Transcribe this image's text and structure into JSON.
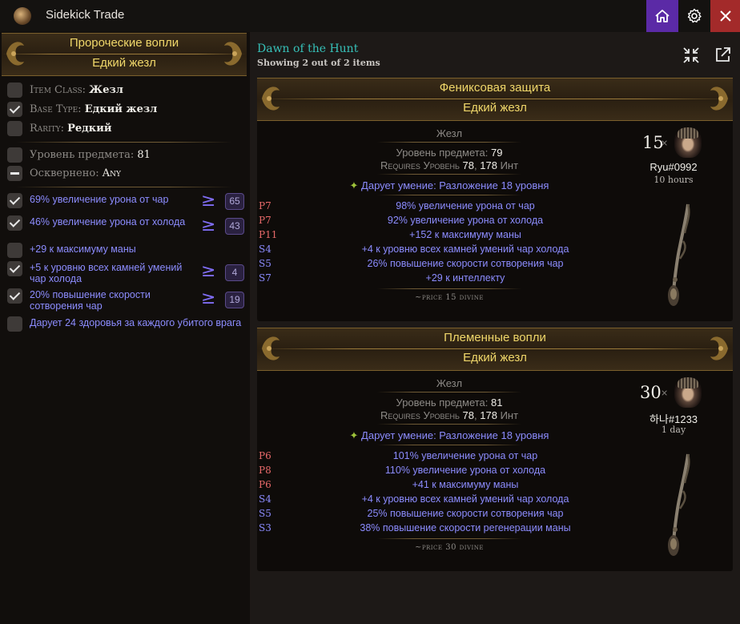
{
  "app": {
    "title": "Sidekick Trade"
  },
  "filters": {
    "banner": {
      "name": "Пророческие вопли",
      "base": "Едкий жезл"
    },
    "rows": [
      {
        "label": "Item Class:",
        "value": "Жезл",
        "state": "off"
      },
      {
        "label": "Base Type:",
        "value": "Едкий жезл",
        "state": "on"
      },
      {
        "label": "Rarity:",
        "value": "Редкий",
        "state": "off"
      },
      {
        "label": "Уровень предмета:",
        "value": "81",
        "state": "off"
      },
      {
        "label": "Осквернено:",
        "value": "Any",
        "state": "minus"
      }
    ],
    "mods": [
      {
        "text": "69% увеличение урона от чар",
        "checked": true,
        "min": "65"
      },
      {
        "text": "46% увеличение урона от холода",
        "checked": true,
        "min": "43"
      },
      {
        "text": "+29 к максимуму маны",
        "checked": false,
        "min": ""
      },
      {
        "text": "+5 к уровню всех камней умений чар холода",
        "checked": true,
        "min": "4"
      },
      {
        "text": "20% повышение скорости сотворения чар",
        "checked": true,
        "min": "19"
      },
      {
        "text": "Дарует 24 здоровья за каждого убитого врага",
        "checked": false,
        "min": ""
      }
    ]
  },
  "results": {
    "league": "Dawn of the Hunt",
    "showing": "Showing 2 out of 2 items",
    "items": [
      {
        "name": "Фениксовая защита",
        "base": "Едкий жезл",
        "item_class": "Жезл",
        "ilvl_label": "Уровень предмета:",
        "ilvl": "79",
        "req_label": "Requires Уровень",
        "req_level": "78",
        "req_int": "178",
        "req_int_label": "Инт",
        "skill": "Дарует умение: Разложение 18 уровня",
        "mods": [
          {
            "tag": "P7",
            "kind": "p",
            "text": "98% увеличение урона от чар"
          },
          {
            "tag": "P7",
            "kind": "p",
            "text": "92% увеличение урона от холода"
          },
          {
            "tag": "P11",
            "kind": "p",
            "text": "+152 к максимуму маны"
          },
          {
            "tag": "S4",
            "kind": "s",
            "text": "+4 к уровню всех камней умений чар холода"
          },
          {
            "tag": "S5",
            "kind": "s",
            "text": "26% повышение скорости сотворения чар"
          },
          {
            "tag": "S7",
            "kind": "s",
            "text": "+29 к интеллекту"
          }
        ],
        "price": "~price 15 divine",
        "stock": "15",
        "seller": "Ryu#0992",
        "age": "10 hours"
      },
      {
        "name": "Племенные вопли",
        "base": "Едкий жезл",
        "item_class": "Жезл",
        "ilvl_label": "Уровень предмета:",
        "ilvl": "81",
        "req_label": "Requires Уровень",
        "req_level": "78",
        "req_int": "178",
        "req_int_label": "Инт",
        "skill": "Дарует умение: Разложение 18 уровня",
        "mods": [
          {
            "tag": "P6",
            "kind": "p",
            "text": "101% увеличение урона от чар"
          },
          {
            "tag": "P8",
            "kind": "p",
            "text": "110% увеличение урона от холода"
          },
          {
            "tag": "P6",
            "kind": "p",
            "text": "+41 к максимуму маны"
          },
          {
            "tag": "S4",
            "kind": "s",
            "text": "+4 к уровню всех камней умений чар холода"
          },
          {
            "tag": "S5",
            "kind": "s",
            "text": "25% повышение скорости сотворения чар"
          },
          {
            "tag": "S3",
            "kind": "s",
            "text": "38% повышение скорости регенерации маны"
          }
        ],
        "price": "~price 30 divine",
        "stock": "30",
        "seller": "하나#1233",
        "age": "1 day"
      }
    ]
  },
  "icons": {
    "home": "home-icon",
    "settings": "gear-icon",
    "close": "close-icon",
    "collapse": "collapse-icon",
    "open_external": "external-link-icon"
  },
  "colors": {
    "accent": "#5b2aa6",
    "close": "#a32a2a",
    "mod_blue": "#8c8cff",
    "prefix_red": "#e86a6a",
    "banner_gold": "#f0d76a",
    "league_teal": "#36c0b8"
  }
}
